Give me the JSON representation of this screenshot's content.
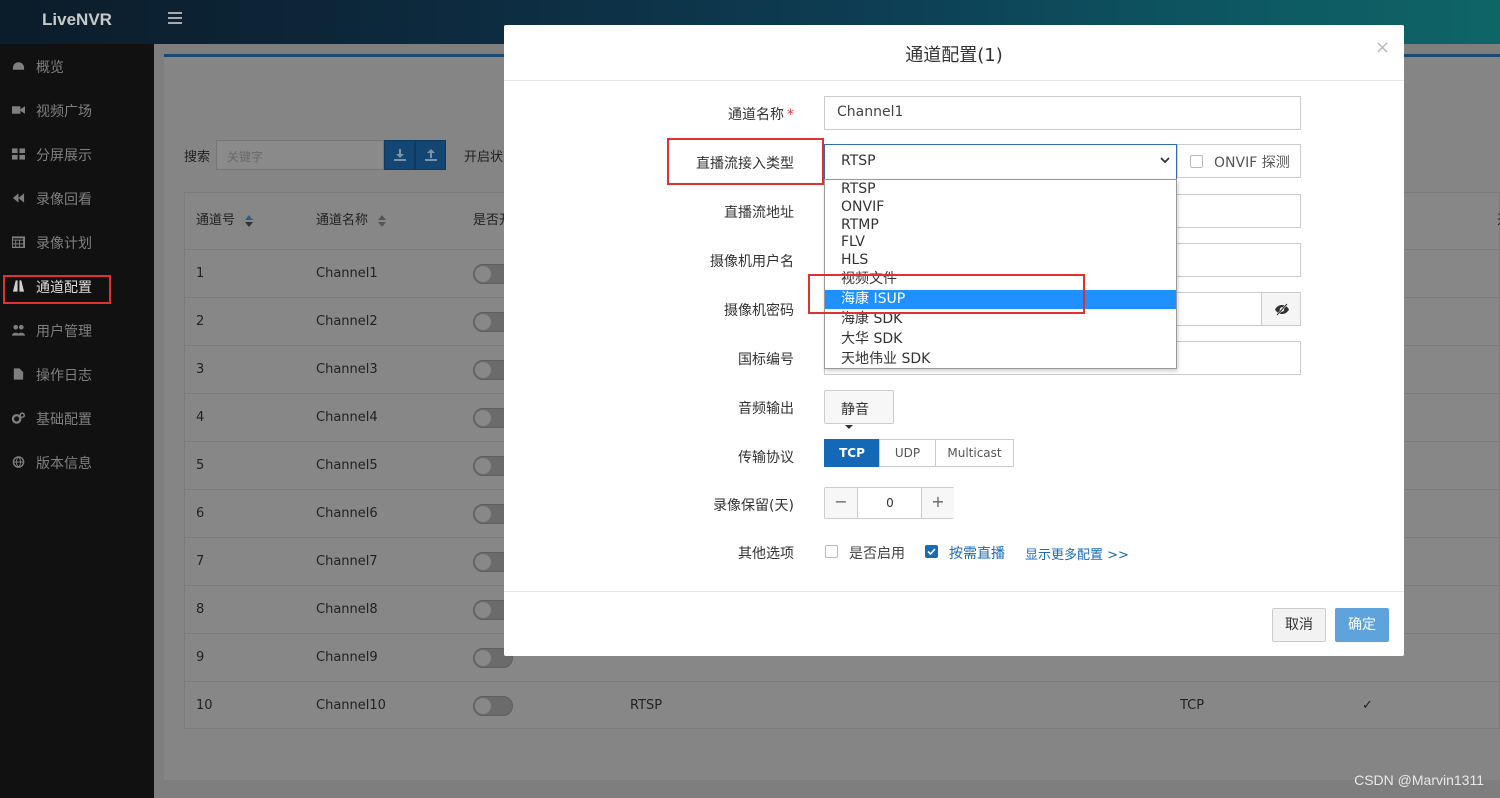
{
  "app": {
    "logo": "LiveNVR"
  },
  "sidebar": {
    "items": [
      {
        "label": "概览",
        "icon": "dashboard-icon"
      },
      {
        "label": "视频广场",
        "icon": "video-camera-icon"
      },
      {
        "label": "分屏展示",
        "icon": "grid-icon"
      },
      {
        "label": "录像回看",
        "icon": "rewind-icon"
      },
      {
        "label": "录像计划",
        "icon": "calendar-icon"
      },
      {
        "label": "通道配置",
        "icon": "road-icon",
        "active": true
      },
      {
        "label": "用户管理",
        "icon": "users-icon"
      },
      {
        "label": "操作日志",
        "icon": "file-icon"
      },
      {
        "label": "基础配置",
        "icon": "gears-icon"
      },
      {
        "label": "版本信息",
        "icon": "globe-icon"
      }
    ]
  },
  "toolbar": {
    "search_label": "搜索",
    "search_placeholder": "关键字",
    "status_label": "开启状态"
  },
  "table": {
    "headers": [
      "通道号",
      "通道名称",
      "是否开启"
    ],
    "right_header_partial": "开",
    "rows": [
      {
        "id": "1",
        "name": "Channel1"
      },
      {
        "id": "2",
        "name": "Channel2"
      },
      {
        "id": "3",
        "name": "Channel3"
      },
      {
        "id": "4",
        "name": "Channel4"
      },
      {
        "id": "5",
        "name": "Channel5"
      },
      {
        "id": "6",
        "name": "Channel6"
      },
      {
        "id": "7",
        "name": "Channel7"
      },
      {
        "id": "8",
        "name": "Channel8"
      },
      {
        "id": "9",
        "name": "Channel9"
      },
      {
        "id": "10",
        "name": "Channel10",
        "type": "RTSP",
        "protocol": "TCP",
        "check": "✓"
      }
    ]
  },
  "modal": {
    "title": "通道配置(1)",
    "close": "×",
    "fields": {
      "name_label": "通道名称",
      "name_required": "*",
      "name_value": "Channel1",
      "stream_type_label": "直播流接入类型",
      "stream_type_value": "RTSP",
      "onvif_label": "ONVIF 探测",
      "stream_url_label": "直播流地址",
      "cam_user_label": "摄像机用户名",
      "cam_pass_label": "摄像机密码",
      "gb_id_label": "国标编号",
      "audio_label": "音频输出",
      "audio_value": "静音",
      "transport_label": "传输协议",
      "transport_options": [
        "TCP",
        "UDP",
        "Multicast"
      ],
      "transport_selected": "TCP",
      "retention_label": "录像保留(天)",
      "retention_value": "0",
      "retention_minus": "−",
      "retention_plus": "+",
      "other_label": "其他选项",
      "enable_label": "是否启用",
      "enable_checked": false,
      "on_demand_label": "按需直播",
      "on_demand_checked": true,
      "more_config_link": "显示更多配置 >>"
    },
    "dropdown_options": [
      "RTSP",
      "ONVIF",
      "RTMP",
      "FLV",
      "HLS",
      "视频文件",
      "海康 ISUP",
      "海康 SDK",
      "大华 SDK",
      "天地伟业 SDK"
    ],
    "dropdown_highlighted": "海康 ISUP",
    "cancel_label": "取消",
    "ok_label": "确定"
  },
  "watermark": "CSDN @Marvin1311",
  "colors": {
    "primary": "#1468b8",
    "highlight": "#1e90ff",
    "annotation_red": "#e03030"
  }
}
